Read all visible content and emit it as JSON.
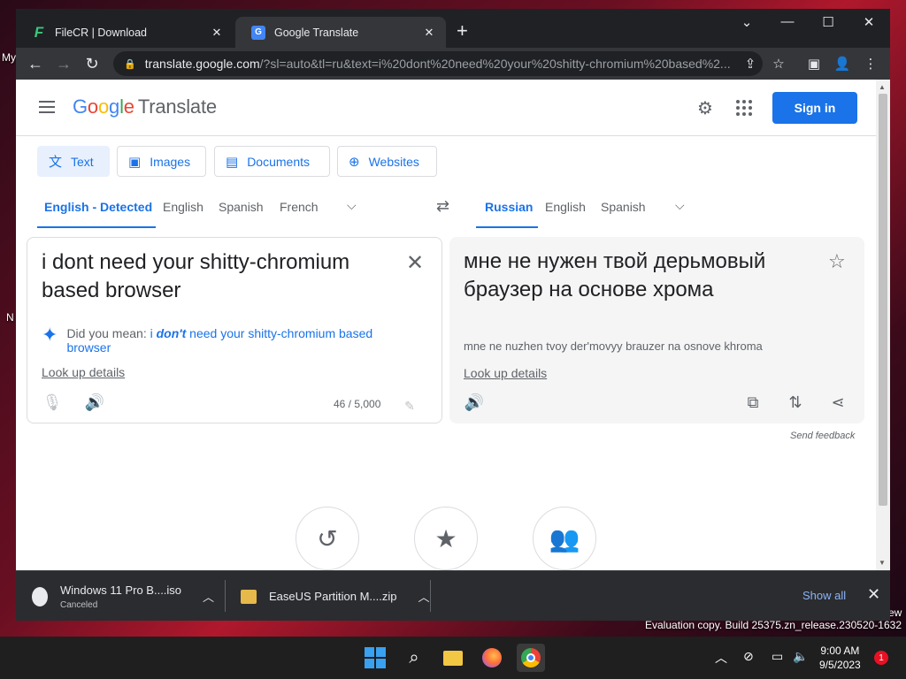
{
  "desktop": {
    "left_fragments": [
      "My",
      "N"
    ],
    "right_fragment": "ew",
    "watermark": "Evaluation copy. Build 25375.zn_release.230520-1632"
  },
  "browser": {
    "tabs": [
      {
        "title": "FileCR | Download",
        "favicon": "filecr-icon",
        "active": false
      },
      {
        "title": "Google Translate",
        "favicon": "google-translate-icon",
        "active": true
      }
    ],
    "new_tab": "+",
    "window_controls": {
      "dropdown": "⌄",
      "minimize": "—",
      "maximize": "☐",
      "close": "✕"
    },
    "url_host": "translate.google.com",
    "url_path": "/?sl=auto&tl=ru&text=i%20dont%20need%20your%20shitty-chromium%20based%2..."
  },
  "gt": {
    "logo_parts": [
      "G",
      "o",
      "o",
      "g",
      "l",
      "e"
    ],
    "product": "Translate",
    "signin": "Sign in",
    "modes": [
      "Text",
      "Images",
      "Documents",
      "Websites"
    ],
    "source_langs": [
      "English - Detected",
      "English",
      "Spanish",
      "French"
    ],
    "target_langs": [
      "Russian",
      "English",
      "Spanish"
    ],
    "source_text": "i dont need your shitty-chromium based browser",
    "did_you_mean_label": "Did you mean:",
    "did_you_mean_pre": "i",
    "did_you_mean_bold": "don't",
    "did_you_mean_post": "need your shitty-chromium based browser",
    "look_up": "Look up details",
    "char_count": "46 / 5,000",
    "target_text": "мне не нужен твой дерьмовый браузер на основе хрома",
    "transliteration": "mne ne nuzhen tvoy der'movyy brauzer na osnove khroma",
    "send_feedback": "Send feedback",
    "accent_color": "#1a73e8"
  },
  "downloads": {
    "items": [
      {
        "name": "Windows 11 Pro B....iso",
        "status": "Canceled"
      },
      {
        "name": "EaseUS Partition M....zip",
        "status": ""
      }
    ],
    "show_all": "Show all"
  },
  "taskbar": {
    "time": "9:00 AM",
    "date": "9/5/2023",
    "notification_count": "1"
  }
}
